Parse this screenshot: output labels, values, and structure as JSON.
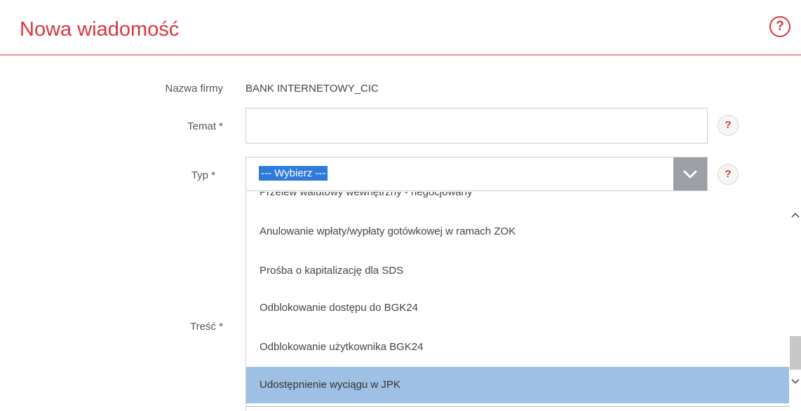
{
  "header": {
    "title": "Nowa wiadomość",
    "help": "?"
  },
  "form": {
    "company_label": "Nazwa firmy",
    "company_value": "BANK INTERNETOWY_CIC",
    "subject_label": "Temat *",
    "subject_value": "",
    "type_label": "Typ *",
    "type_selected": "--- Wybierz ---",
    "content_label": "Treść *",
    "help": "?"
  },
  "dropdown": {
    "options": [
      "Przelew walutowy wewnętrzny - negocjowany",
      "Anulowanie wpłaty/wypłaty gotówkowej w ramach ZOK",
      "Prośba o kapitalizację dla SDS",
      "Odblokowanie dostępu do BGK24",
      "Odblokowanie użytkownika BGK24",
      "Udostępnienie wyciągu w JPK"
    ],
    "highlighted_index": 5
  },
  "colors": {
    "accent": "#d9363e",
    "selection": "#2f7bdc",
    "highlight": "#9ec0e4"
  }
}
